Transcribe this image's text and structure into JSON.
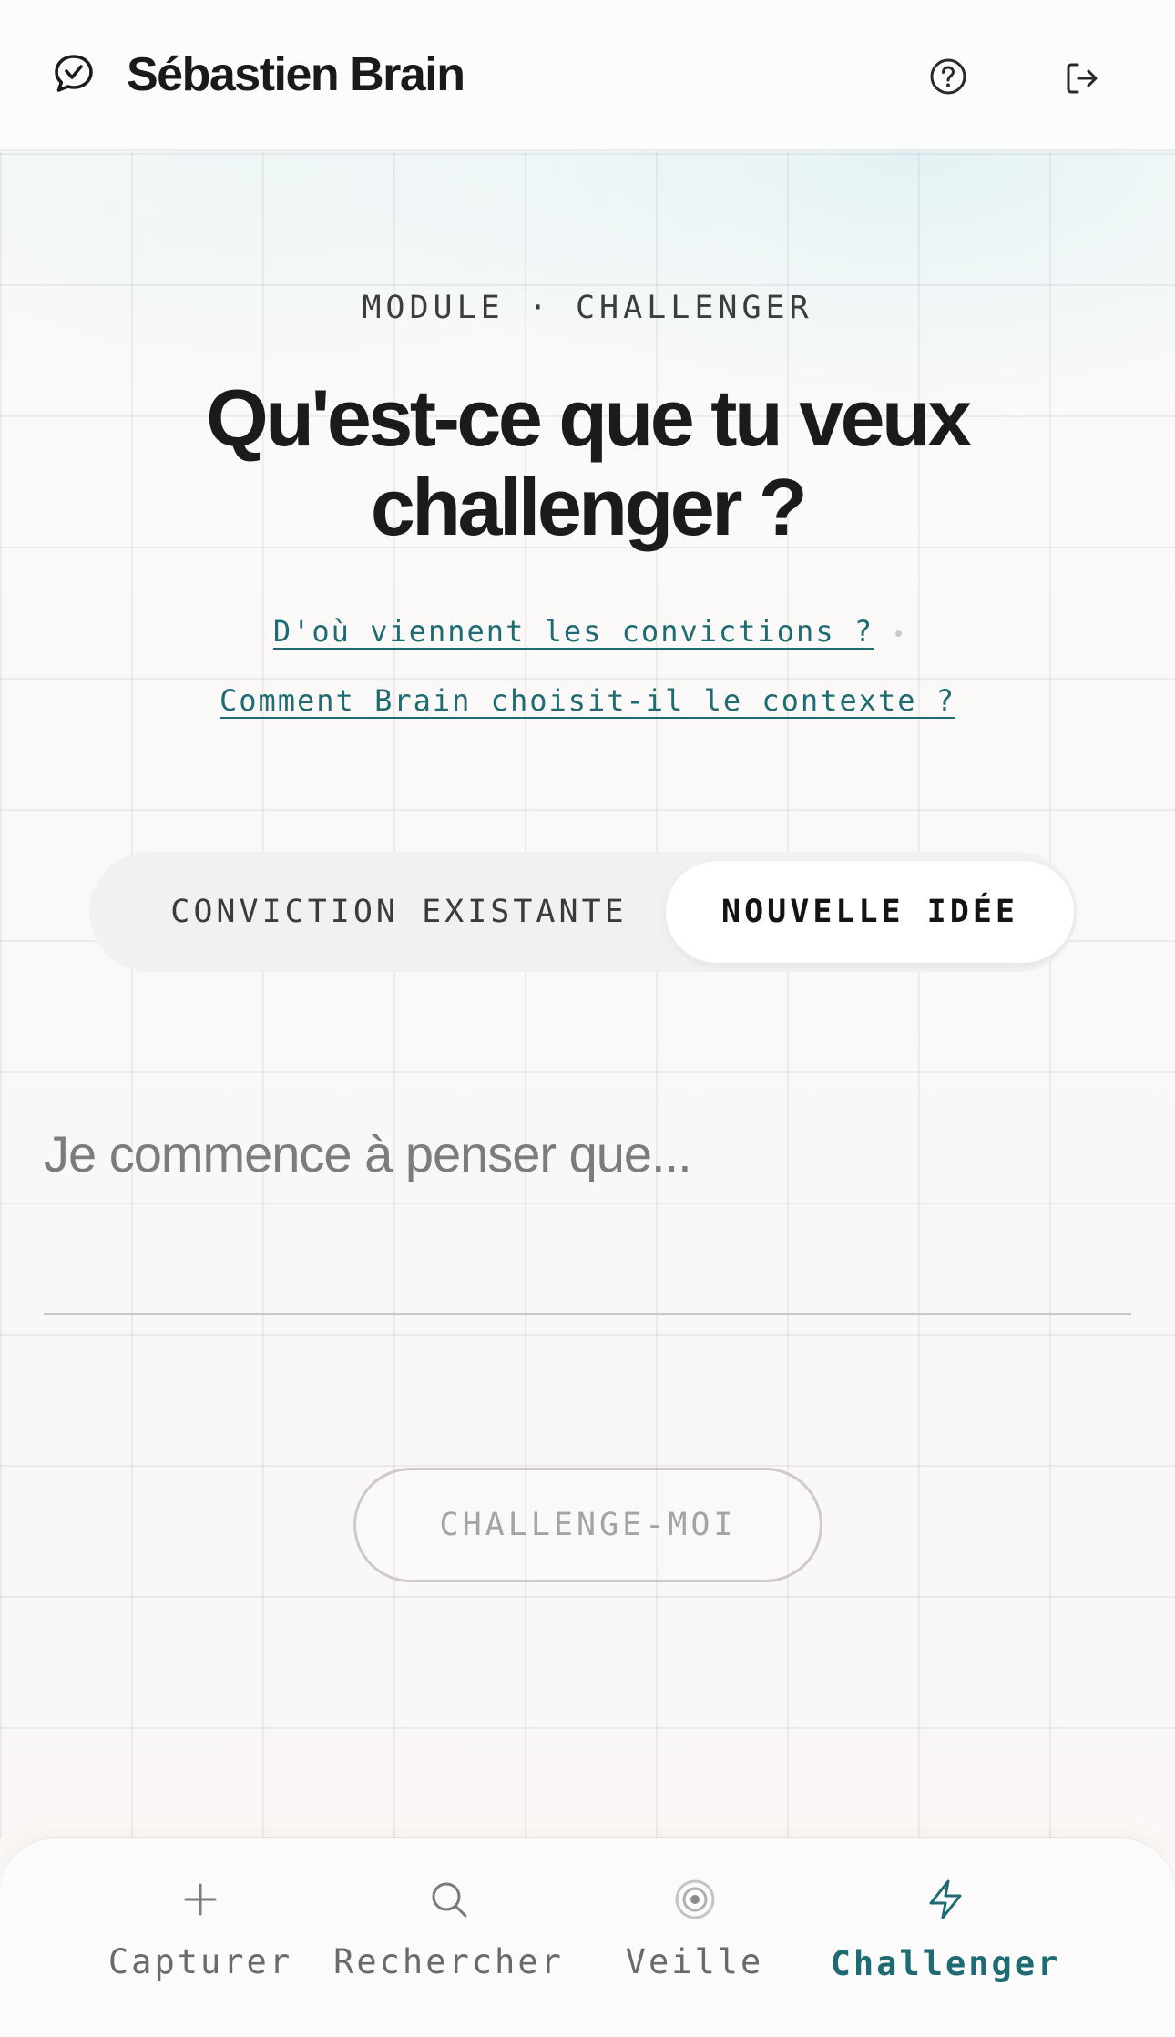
{
  "header": {
    "brand": "Sébastien Brain",
    "icons": {
      "logo": "chat-bubble-icon",
      "help": "help-circle-icon",
      "logout": "logout-icon"
    }
  },
  "hero": {
    "eyebrow": "MODULE · CHALLENGER",
    "title": "Qu'est-ce que tu veux challenger ?",
    "links": [
      "D'où viennent les convictions ?",
      "Comment Brain choisit-il le contexte ?"
    ]
  },
  "segment": {
    "options": [
      "CONVICTION EXISTANTE",
      "NOUVELLE IDÉE"
    ],
    "selected": "NOUVELLE IDÉE"
  },
  "input": {
    "placeholder": "Je commence à penser que...",
    "value": ""
  },
  "cta": {
    "label": "CHALLENGE-MOI",
    "enabled": false
  },
  "nav": {
    "items": [
      {
        "label": "Capturer",
        "icon": "plus-icon"
      },
      {
        "label": "Rechercher",
        "icon": "search-icon"
      },
      {
        "label": "Veille",
        "icon": "radar-icon"
      },
      {
        "label": "Challenger",
        "icon": "lightning-icon"
      }
    ],
    "active": "Challenger"
  },
  "colors": {
    "accent": "#1f6b73",
    "text": "#1b1b1b",
    "muted": "#6a6a6a",
    "background": "#faf7f5"
  }
}
